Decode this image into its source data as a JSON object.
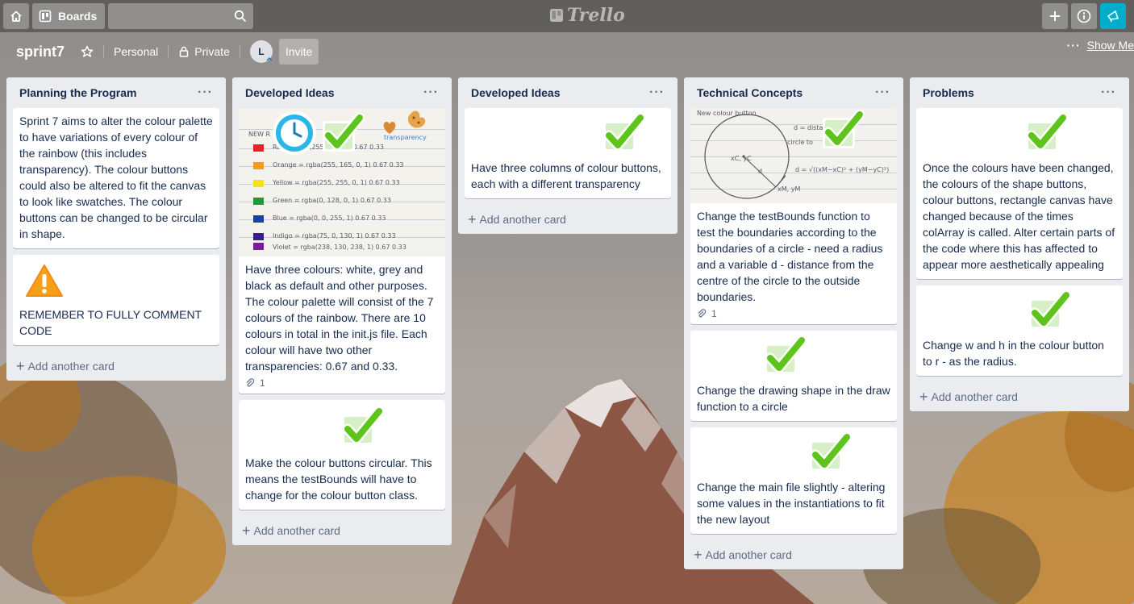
{
  "header": {
    "boards_label": "Boards",
    "search_placeholder": "",
    "logo_text": "Trello"
  },
  "board": {
    "title": "sprint7",
    "team": "Personal",
    "visibility": "Private",
    "member_initial": "L",
    "invite_label": "Invite",
    "show_menu_label": "Show Me"
  },
  "lists": [
    {
      "title": "Planning the Program",
      "cards": [
        {
          "text": "Sprint 7 aims to alter the colour palette to have variations of every colour of the rainbow (this includes transparency). The colour buttons could also be altered to fit the canvas to look like swatches. The colour buttons can be changed to be circular in shape."
        },
        {
          "text": "REMEMBER TO FULLY COMMENT CODE",
          "sticker": "warning-sticker"
        }
      ],
      "add_label": "Add another card"
    },
    {
      "title": "Developed Ideas",
      "cards": [
        {
          "text": "Have three colours: white, grey and black as default and other purposes. The colour palette will consist of the 7 colours of the rainbow. There are 10 colours in total in the init.js file. Each colour will have two other transparencies: 0.67 and 0.33.",
          "attachments": "1",
          "cover": {
            "heading": "NEW R",
            "transparency_label": "transparency",
            "rows": [
              {
                "name": "Red",
                "value": "rgba(255, 0, 0, 1)  0.67  0.33",
                "color": "#e8222a"
              },
              {
                "name": "Orange",
                "value": "rgba(255, 165, 0, 1)  0.67  0.33",
                "color": "#f59a1b"
              },
              {
                "name": "Yellow",
                "value": "rgba(255, 255, 0, 1)  0.67  0.33",
                "color": "#f5e11b"
              },
              {
                "name": "Green",
                "value": "rgba(0, 128, 0, 1)  0.67  0.33",
                "color": "#1f9a3a"
              },
              {
                "name": "Blue",
                "value": "rgba(0, 0, 255, 1)  0.67  0.33",
                "color": "#1b3fa8"
              },
              {
                "name": "Indigo",
                "value": "rgba(75, 0, 130, 1)  0.67  0.33",
                "color": "#3a1b8a"
              },
              {
                "name": "Violet",
                "value": "rgba(238, 130, 238, 1)  0.67  0.33",
                "color": "#7a1ba8"
              }
            ]
          }
        },
        {
          "text": "Make the colour buttons circular. This means the testBounds will have to change for the colour button class.",
          "sticker": "check-sticker"
        }
      ],
      "add_label": "Add another card"
    },
    {
      "title": "Developed Ideas",
      "cards": [
        {
          "text": "Have three columns of colour buttons, each with a different transparency",
          "sticker": "check-sticker"
        }
      ],
      "add_label": "Add another card"
    },
    {
      "title": "Technical Concepts",
      "cards": [
        {
          "text": "Change the testBounds function to test the boundaries according to the boundaries of a circle - need a radius and a variable d - distance from the centre of the circle to the outside boundaries.",
          "attachments": "1",
          "cover": {
            "heading": "New colour button",
            "note1": "d = distance",
            "note2": "circle to",
            "formula": "d = √((xM−xC)² + (yM−yC)²)",
            "center_label": "xC, yC",
            "mouse_label": "xM, yM",
            "d_label": "d"
          }
        },
        {
          "text": "Change the drawing shape in the draw function to a circle",
          "sticker": "check-sticker"
        },
        {
          "text": "Change the main file slightly - altering some values in the instantiations to fit the new layout",
          "sticker": "check-sticker"
        }
      ],
      "add_label": "Add another card"
    },
    {
      "title": "Problems",
      "cards": [
        {
          "text": "Once the colours have been changed, the colours of the shape buttons, colour buttons, rectangle canvas have changed because of the times colArray is called. Alter certain parts of the code where this has affected to appear more aesthetically appealing",
          "sticker": "check-sticker"
        },
        {
          "text": "Change w and h in the colour button to r - as the radius.",
          "sticker": "check-sticker"
        }
      ],
      "add_label": "Add another card"
    }
  ],
  "colors": {
    "list_bg": "#ebecf0",
    "check_green": "#5cc41a",
    "notification": "#00aecc"
  }
}
